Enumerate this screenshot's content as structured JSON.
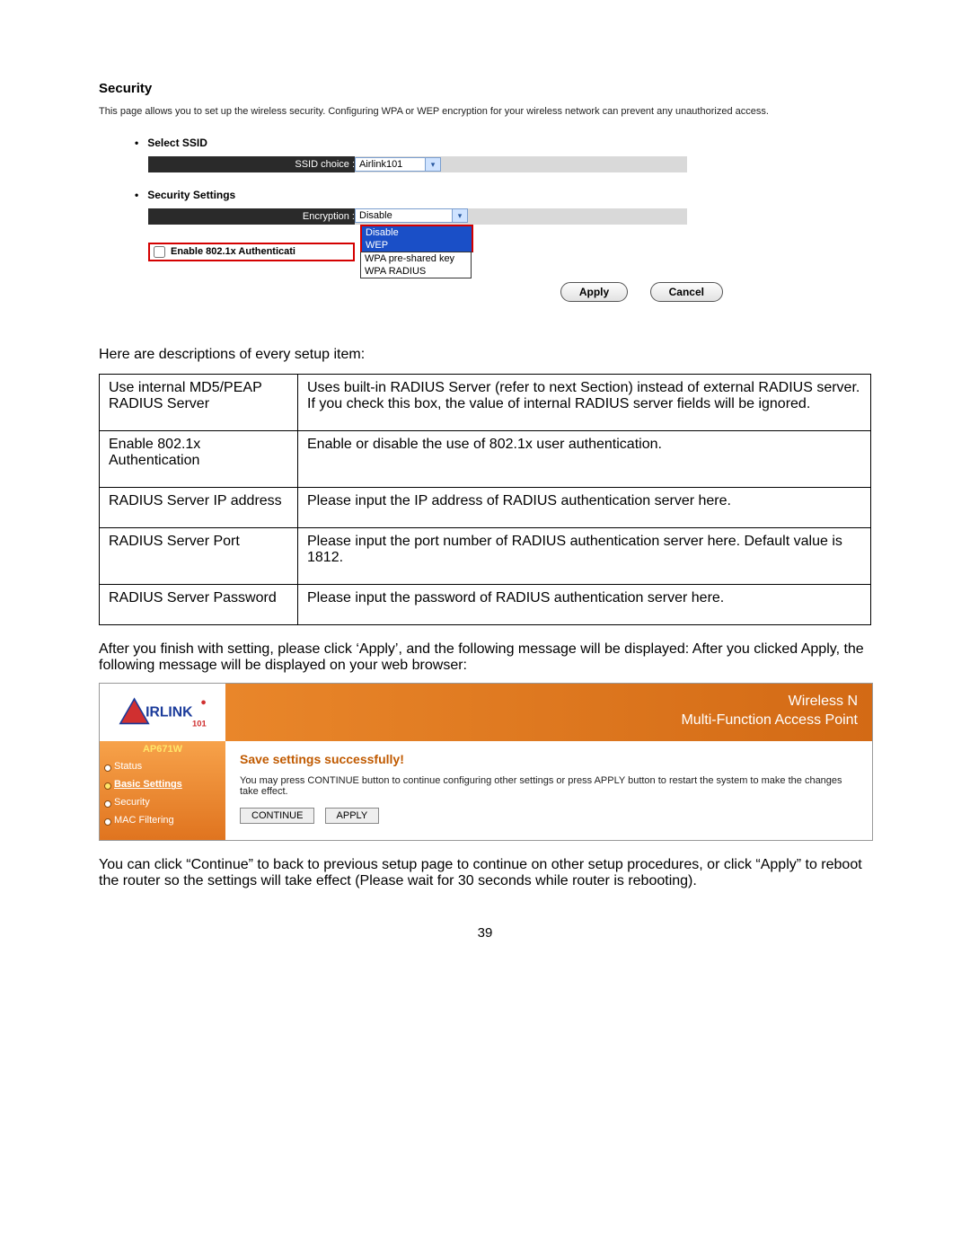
{
  "security": {
    "title": "Security",
    "description": "This page allows you to set up the wireless security. Configuring WPA or WEP encryption for your wireless network can prevent any unauthorized access.",
    "selectSsidHeading": "Select SSID",
    "ssidLabel": "SSID choice :",
    "ssidValue": "Airlink101",
    "securitySettingsHeading": "Security Settings",
    "encryptionLabel": "Encryption :",
    "encryptionSelected": "Disable",
    "encryptionOptions": {
      "o0": "Disable",
      "o1": "WEP",
      "o2": "WPA pre-shared key",
      "o3": "WPA RADIUS"
    },
    "enable8021xLabel": "Enable 802.1x Authenticati",
    "applyBtn": "Apply",
    "cancelBtn": "Cancel"
  },
  "intro": "Here are descriptions of every setup item:",
  "table": {
    "r0": {
      "k": "Use internal MD5/PEAP RADIUS Server",
      "v": "Uses built-in RADIUS Server (refer to next Section) instead of external RADIUS server. If you check this box, the value of internal RADIUS server fields will be ignored."
    },
    "r1": {
      "k": "Enable 802.1x Authentication",
      "v": "Enable or disable the use of 802.1x user authentication."
    },
    "r2": {
      "k": "RADIUS Server IP address",
      "v": "Please input the IP address of RADIUS authentication server here."
    },
    "r3": {
      "k": "RADIUS Server Port",
      "v": "Please input the port number of RADIUS authentication server here. Default value is 1812."
    },
    "r4": {
      "k": "RADIUS Server Password",
      "v": "Please input the password of RADIUS authentication server here."
    }
  },
  "afterText": "After you finish with setting, please click ‘Apply’, and the following message will be displayed: After you clicked Apply, the following message will be displayed on your web browser:",
  "router": {
    "bannerLine1": "Wireless N",
    "bannerLine2": "Multi-Function Access Point",
    "model": "AP671W",
    "nav": {
      "n0": "Status",
      "n1": "Basic Settings",
      "n2": "Security",
      "n3": "MAC Filtering"
    },
    "saveTitle": "Save settings successfully!",
    "saveText": "You may press CONTINUE button to continue configuring other settings or press APPLY button to restart the system to make the changes take effect.",
    "continueBtn": "CONTINUE",
    "applyBtn": "APPLY"
  },
  "closingText": "You can click “Continue” to back to previous setup page to continue on other setup procedures, or click “Apply” to reboot the router so the settings will take effect (Please wait for 30 seconds while router is rebooting).",
  "pageNumber": "39"
}
